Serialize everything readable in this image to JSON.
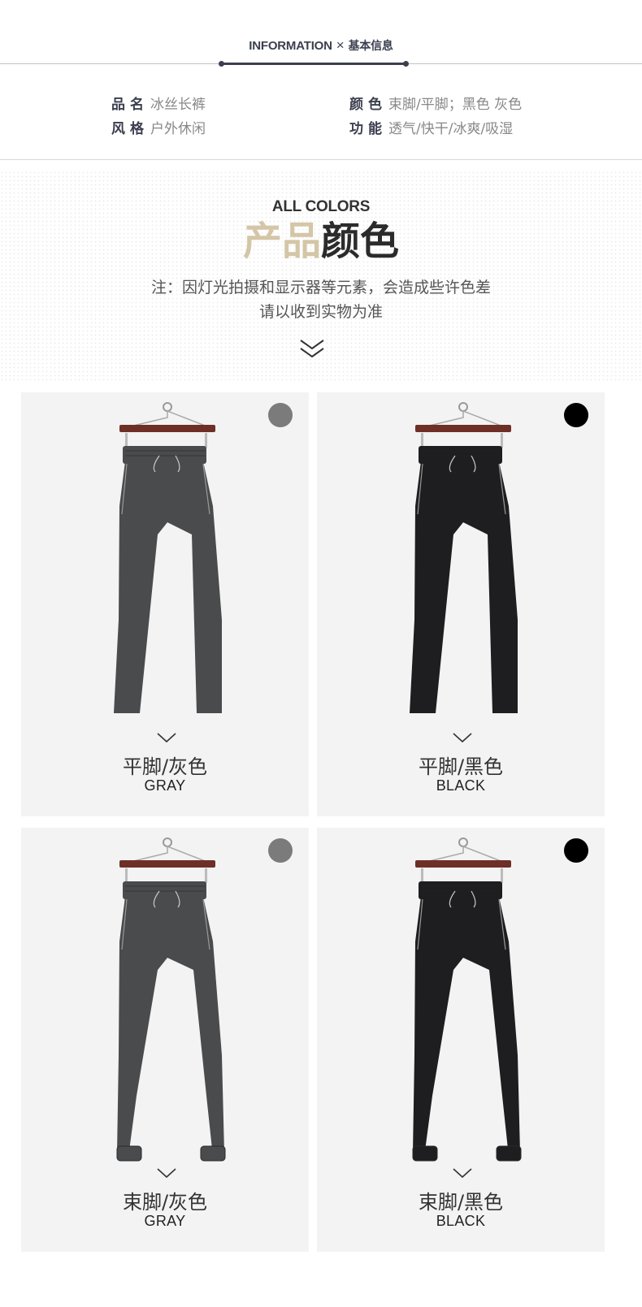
{
  "info": {
    "title_en": "INFORMATION",
    "separator": "×",
    "title_cn": "基本信息"
  },
  "specs": [
    {
      "key": "品名",
      "value": "冰丝长裤"
    },
    {
      "key": "风格",
      "value": "户外休闲"
    },
    {
      "key": "颜色",
      "value": "束脚/平脚；黑色 灰色"
    },
    {
      "key": "功能",
      "value": "透气/快干/冰爽/吸湿"
    }
  ],
  "colors_section": {
    "eyebrow": "ALL COLORS",
    "title_part1": "产品",
    "title_part2": "颜色",
    "note_line1": "注：因灯光拍摄和显示器等元素，会造成些许色差",
    "note_line2": "请以收到实物为准",
    "chevron_icon": "double-chevron-down-icon"
  },
  "products": [
    {
      "name_cn": "平脚/灰色",
      "name_en": "GRAY",
      "swatch": "#7b7b7b",
      "pants_color": "#4a4b4d",
      "cuff": false
    },
    {
      "name_cn": "平脚/黑色",
      "name_en": "BLACK",
      "swatch": "#000000",
      "pants_color": "#1e1e20",
      "cuff": false
    },
    {
      "name_cn": "束脚/灰色",
      "name_en": "GRAY",
      "swatch": "#7b7b7b",
      "pants_color": "#4a4b4d",
      "cuff": true
    },
    {
      "name_cn": "束脚/黑色",
      "name_en": "BLACK",
      "swatch": "#000000",
      "pants_color": "#1e1e20",
      "cuff": true
    }
  ]
}
